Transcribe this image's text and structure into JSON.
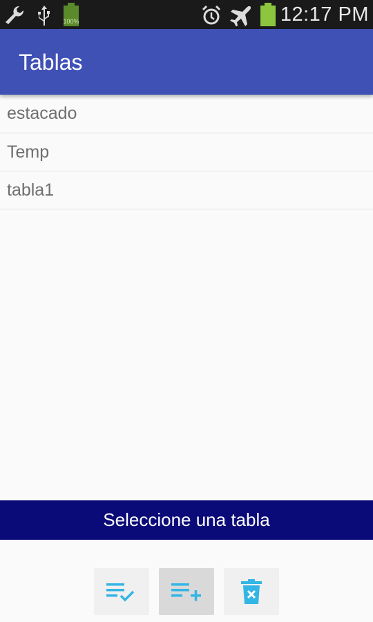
{
  "status_bar": {
    "time": "12:17 PM",
    "battery_label": "100%",
    "icons": [
      "wrench-icon",
      "usb-icon",
      "battery-full-icon",
      "alarm-icon",
      "airplane-mode-icon",
      "battery-charging-icon"
    ]
  },
  "toolbar": {
    "title": "Tablas"
  },
  "tables": {
    "items": [
      {
        "label": "estacado"
      },
      {
        "label": "Temp"
      },
      {
        "label": "tabla1"
      }
    ]
  },
  "banner": {
    "text": "Seleccione una tabla"
  },
  "actions": {
    "buttons": [
      {
        "icon": "playlist-check-icon",
        "active": false
      },
      {
        "icon": "playlist-add-icon",
        "active": true
      },
      {
        "icon": "delete-icon",
        "active": false
      }
    ]
  },
  "colors": {
    "toolbar": "#3f51b5",
    "banner": "#0a0a78",
    "icon_accent": "#33b5e5",
    "battery_green": "#8cc63f"
  }
}
